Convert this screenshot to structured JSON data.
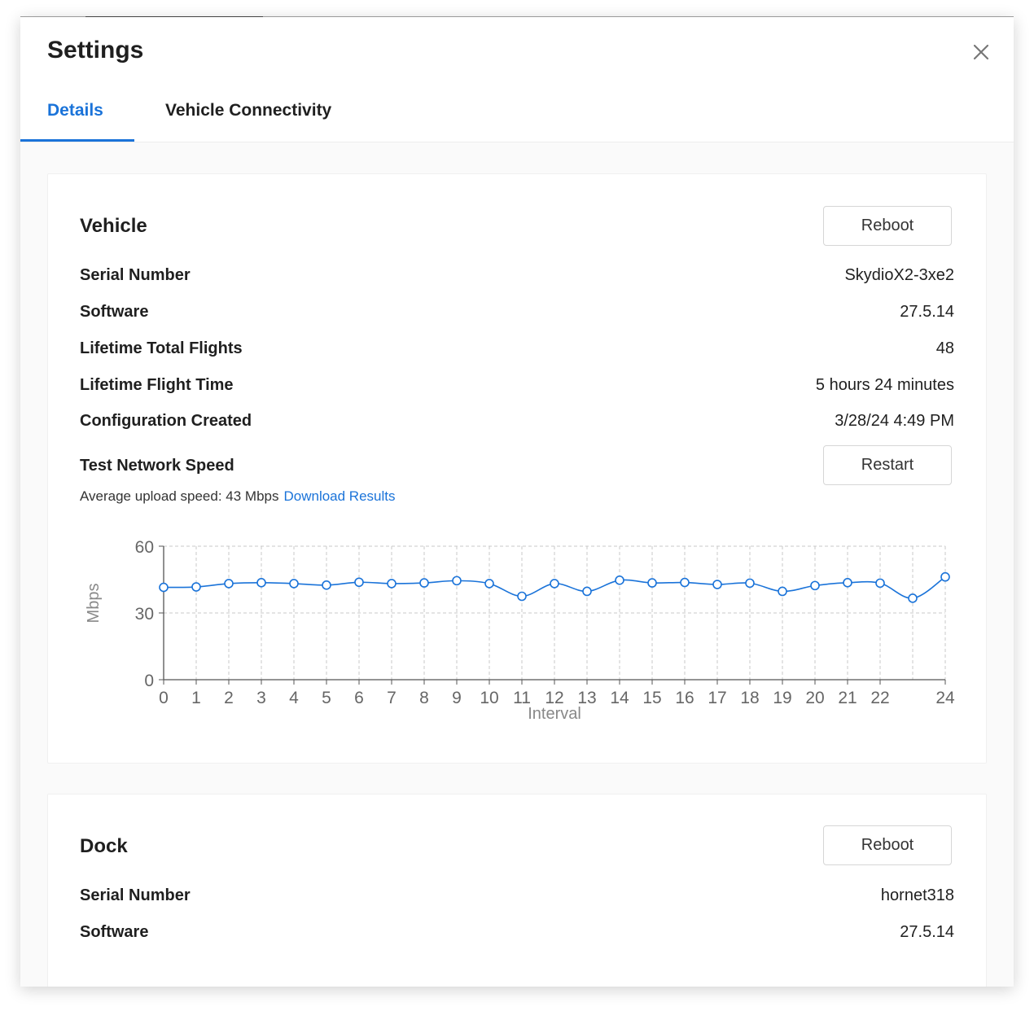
{
  "modal": {
    "title": "Settings",
    "close_icon": "close-icon",
    "tabs": [
      {
        "label": "Details",
        "active": true
      },
      {
        "label": "Vehicle Connectivity",
        "active": false
      }
    ]
  },
  "vehicle": {
    "title": "Vehicle",
    "reboot_label": "Reboot",
    "rows": [
      {
        "label": "Serial Number",
        "value": "SkydioX2-3xe2"
      },
      {
        "label": "Software",
        "value": "27.5.14"
      },
      {
        "label": "Lifetime Total Flights",
        "value": "48"
      },
      {
        "label": "Lifetime Flight Time",
        "value": "5 hours 24 minutes"
      },
      {
        "label": "Configuration Created",
        "value": "3/28/24 4:49 PM"
      }
    ],
    "network": {
      "label": "Test Network Speed",
      "restart_label": "Restart",
      "average_text": "Average upload speed: 43 Mbps",
      "download_link": "Download Results"
    }
  },
  "dock": {
    "title": "Dock",
    "reboot_label": "Reboot",
    "rows": [
      {
        "label": "Serial Number",
        "value": "hornet318"
      },
      {
        "label": "Software",
        "value": "27.5.14"
      }
    ]
  },
  "colors": {
    "accent": "#1a73d9",
    "line": "#1a73d9"
  },
  "chart_data": {
    "type": "line",
    "xlabel": "Interval",
    "ylabel": "Mbps",
    "xlim": [
      0,
      24
    ],
    "ylim": [
      0,
      60
    ],
    "grid": true,
    "x_ticks": [
      "0",
      "1",
      "2",
      "3",
      "4",
      "5",
      "6",
      "7",
      "8",
      "9",
      "10",
      "11",
      "12",
      "13",
      "14",
      "15",
      "16",
      "17",
      "18",
      "19",
      "20",
      "21",
      "22",
      "24"
    ],
    "x_tick_values": [
      0,
      1,
      2,
      3,
      4,
      5,
      6,
      7,
      8,
      9,
      10,
      11,
      12,
      13,
      14,
      15,
      16,
      17,
      18,
      19,
      20,
      21,
      22,
      24
    ],
    "y_ticks": [
      "0",
      "30",
      "60"
    ],
    "y_tick_values": [
      0,
      30,
      60
    ],
    "x": [
      0,
      1,
      2,
      3,
      4,
      5,
      6,
      7,
      8,
      9,
      10,
      11,
      12,
      13,
      14,
      15,
      16,
      17,
      18,
      19,
      20,
      21,
      22,
      23,
      24
    ],
    "values": [
      41.5,
      41.7,
      43.2,
      43.6,
      43.2,
      42.5,
      43.8,
      43.2,
      43.5,
      44.5,
      43.2,
      37.5,
      43.2,
      39.7,
      44.7,
      43.5,
      43.7,
      42.8,
      43.4,
      39.7,
      42.3,
      43.6,
      43.4,
      36.6,
      46.2
    ]
  }
}
